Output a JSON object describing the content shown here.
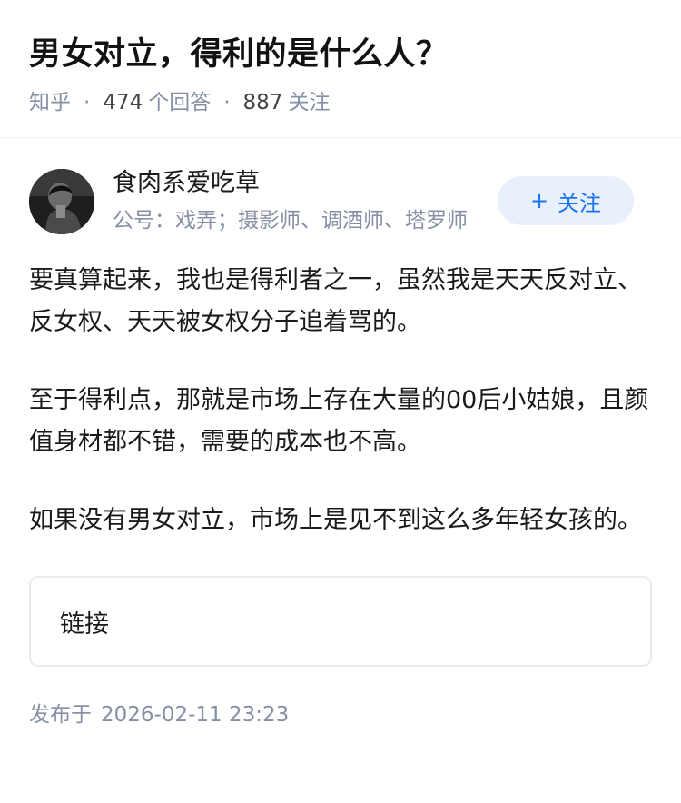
{
  "question": {
    "title": "男女对立，得利的是什么人？",
    "source": "知乎",
    "answers_count": "474",
    "answers_label": "个回答",
    "followers_count": "887",
    "followers_label": "关注"
  },
  "author": {
    "name": "食肉系爱吃草",
    "bio": "公号：戏弄；摄影师、调酒师、塔罗师",
    "follow_label": "关注",
    "follow_icon": "plus-icon"
  },
  "answer": {
    "paragraphs": [
      "要真算起来，我也是得利者之一，虽然我是天天反对立、反女权、天天被女权分子追着骂的。",
      "至于得利点，那就是市场上存在大量的00后小姑娘，且颜值身材都不错，需要的成本也不高。",
      "如果没有男女对立，市场上是见不到这么多年轻女孩的。"
    ],
    "link_card_label": "链接"
  },
  "publish": {
    "label": "发布于",
    "time": "2026-02-11 23:23"
  }
}
